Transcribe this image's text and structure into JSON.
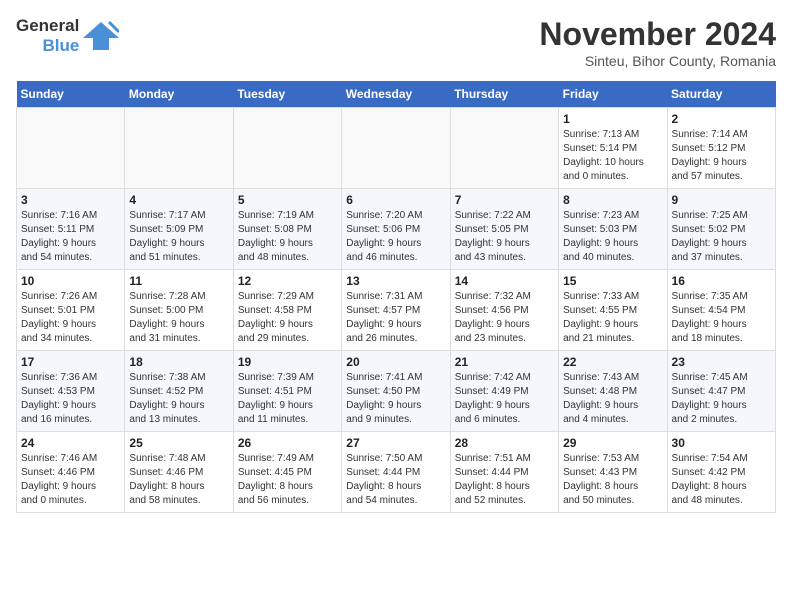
{
  "header": {
    "logo_general": "General",
    "logo_blue": "Blue",
    "title": "November 2024",
    "subtitle": "Sinteu, Bihor County, Romania"
  },
  "calendar": {
    "days_of_week": [
      "Sunday",
      "Monday",
      "Tuesday",
      "Wednesday",
      "Thursday",
      "Friday",
      "Saturday"
    ],
    "weeks": [
      [
        {
          "day": "",
          "info": ""
        },
        {
          "day": "",
          "info": ""
        },
        {
          "day": "",
          "info": ""
        },
        {
          "day": "",
          "info": ""
        },
        {
          "day": "",
          "info": ""
        },
        {
          "day": "1",
          "info": "Sunrise: 7:13 AM\nSunset: 5:14 PM\nDaylight: 10 hours\nand 0 minutes."
        },
        {
          "day": "2",
          "info": "Sunrise: 7:14 AM\nSunset: 5:12 PM\nDaylight: 9 hours\nand 57 minutes."
        }
      ],
      [
        {
          "day": "3",
          "info": "Sunrise: 7:16 AM\nSunset: 5:11 PM\nDaylight: 9 hours\nand 54 minutes."
        },
        {
          "day": "4",
          "info": "Sunrise: 7:17 AM\nSunset: 5:09 PM\nDaylight: 9 hours\nand 51 minutes."
        },
        {
          "day": "5",
          "info": "Sunrise: 7:19 AM\nSunset: 5:08 PM\nDaylight: 9 hours\nand 48 minutes."
        },
        {
          "day": "6",
          "info": "Sunrise: 7:20 AM\nSunset: 5:06 PM\nDaylight: 9 hours\nand 46 minutes."
        },
        {
          "day": "7",
          "info": "Sunrise: 7:22 AM\nSunset: 5:05 PM\nDaylight: 9 hours\nand 43 minutes."
        },
        {
          "day": "8",
          "info": "Sunrise: 7:23 AM\nSunset: 5:03 PM\nDaylight: 9 hours\nand 40 minutes."
        },
        {
          "day": "9",
          "info": "Sunrise: 7:25 AM\nSunset: 5:02 PM\nDaylight: 9 hours\nand 37 minutes."
        }
      ],
      [
        {
          "day": "10",
          "info": "Sunrise: 7:26 AM\nSunset: 5:01 PM\nDaylight: 9 hours\nand 34 minutes."
        },
        {
          "day": "11",
          "info": "Sunrise: 7:28 AM\nSunset: 5:00 PM\nDaylight: 9 hours\nand 31 minutes."
        },
        {
          "day": "12",
          "info": "Sunrise: 7:29 AM\nSunset: 4:58 PM\nDaylight: 9 hours\nand 29 minutes."
        },
        {
          "day": "13",
          "info": "Sunrise: 7:31 AM\nSunset: 4:57 PM\nDaylight: 9 hours\nand 26 minutes."
        },
        {
          "day": "14",
          "info": "Sunrise: 7:32 AM\nSunset: 4:56 PM\nDaylight: 9 hours\nand 23 minutes."
        },
        {
          "day": "15",
          "info": "Sunrise: 7:33 AM\nSunset: 4:55 PM\nDaylight: 9 hours\nand 21 minutes."
        },
        {
          "day": "16",
          "info": "Sunrise: 7:35 AM\nSunset: 4:54 PM\nDaylight: 9 hours\nand 18 minutes."
        }
      ],
      [
        {
          "day": "17",
          "info": "Sunrise: 7:36 AM\nSunset: 4:53 PM\nDaylight: 9 hours\nand 16 minutes."
        },
        {
          "day": "18",
          "info": "Sunrise: 7:38 AM\nSunset: 4:52 PM\nDaylight: 9 hours\nand 13 minutes."
        },
        {
          "day": "19",
          "info": "Sunrise: 7:39 AM\nSunset: 4:51 PM\nDaylight: 9 hours\nand 11 minutes."
        },
        {
          "day": "20",
          "info": "Sunrise: 7:41 AM\nSunset: 4:50 PM\nDaylight: 9 hours\nand 9 minutes."
        },
        {
          "day": "21",
          "info": "Sunrise: 7:42 AM\nSunset: 4:49 PM\nDaylight: 9 hours\nand 6 minutes."
        },
        {
          "day": "22",
          "info": "Sunrise: 7:43 AM\nSunset: 4:48 PM\nDaylight: 9 hours\nand 4 minutes."
        },
        {
          "day": "23",
          "info": "Sunrise: 7:45 AM\nSunset: 4:47 PM\nDaylight: 9 hours\nand 2 minutes."
        }
      ],
      [
        {
          "day": "24",
          "info": "Sunrise: 7:46 AM\nSunset: 4:46 PM\nDaylight: 9 hours\nand 0 minutes."
        },
        {
          "day": "25",
          "info": "Sunrise: 7:48 AM\nSunset: 4:46 PM\nDaylight: 8 hours\nand 58 minutes."
        },
        {
          "day": "26",
          "info": "Sunrise: 7:49 AM\nSunset: 4:45 PM\nDaylight: 8 hours\nand 56 minutes."
        },
        {
          "day": "27",
          "info": "Sunrise: 7:50 AM\nSunset: 4:44 PM\nDaylight: 8 hours\nand 54 minutes."
        },
        {
          "day": "28",
          "info": "Sunrise: 7:51 AM\nSunset: 4:44 PM\nDaylight: 8 hours\nand 52 minutes."
        },
        {
          "day": "29",
          "info": "Sunrise: 7:53 AM\nSunset: 4:43 PM\nDaylight: 8 hours\nand 50 minutes."
        },
        {
          "day": "30",
          "info": "Sunrise: 7:54 AM\nSunset: 4:42 PM\nDaylight: 8 hours\nand 48 minutes."
        }
      ]
    ]
  }
}
